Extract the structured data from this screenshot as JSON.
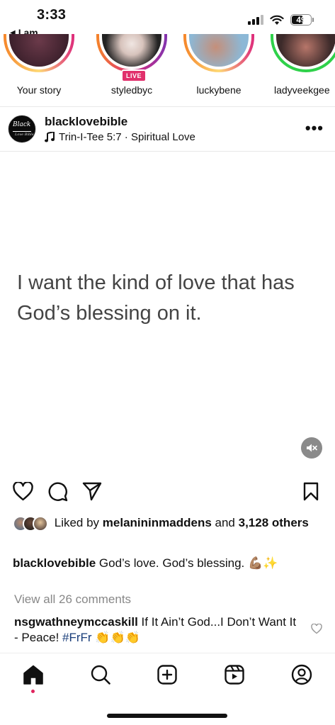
{
  "status_bar": {
    "time": "3:33",
    "back_label": "I am",
    "battery": "49"
  },
  "stories": [
    {
      "name": "Your story",
      "ring": "#ff6b3d"
    },
    {
      "name": "styledbyc",
      "ring": "#e1306c",
      "badge": "LIVE"
    },
    {
      "name": "luckybene",
      "ring": "#f58529"
    },
    {
      "name": "ladyveekgee",
      "ring": "#2fd14a"
    }
  ],
  "post": {
    "username": "blacklovebible",
    "music": "Trin-I-Tee 5:7 · Spiritual Love",
    "avatar_text_1": "Black",
    "avatar_text_2": "Love Bible",
    "quote": "I want the kind of love that has God’s blessing on it.",
    "likes": {
      "prefix": "Liked by",
      "user": "melanininmaddens",
      "middle": "and",
      "count": "3,128 others"
    },
    "caption": {
      "user": "blacklovebible",
      "text": "God’s love. God’s blessing. 💪🏽✨"
    },
    "view_all": "View all 26 comments",
    "comment": {
      "user": "nsgwathneymccaskill",
      "text": "If It Ain’t God...I Don’t Want It - Peace!",
      "hashtag": "#FrFr",
      "emoji": "👏👏👏"
    }
  },
  "colors": {
    "accent_red": "#e0245e",
    "hashtag": "#1a3e7a"
  },
  "icons": [
    "heart-icon",
    "comment-icon",
    "share-icon",
    "bookmark-icon",
    "home-icon",
    "search-icon",
    "create-icon",
    "reels-icon",
    "profile-icon",
    "mute-icon",
    "music-note-icon"
  ]
}
